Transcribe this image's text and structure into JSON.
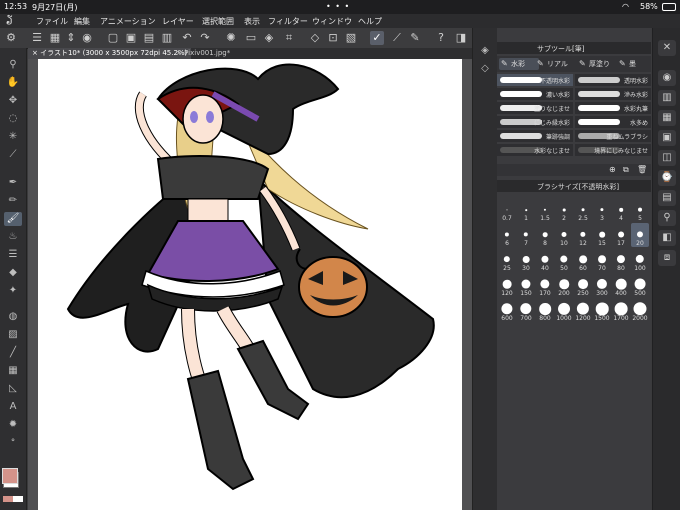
{
  "status": {
    "time": "12:53",
    "date": "9月27日(月)",
    "battery": "58%",
    "dots": "• • •"
  },
  "menu": [
    "ファイル",
    "編集",
    "アニメーション",
    "レイヤー",
    "選択範囲",
    "表示",
    "フィルター",
    "ウィンドウ",
    "ヘルプ"
  ],
  "tabs": [
    {
      "label": "イラスト10* (3000 x 3500px 72dpi 45.2%)"
    },
    {
      "label": "Pixiv001.jpg*"
    }
  ],
  "toolbar": {
    "icons": [
      "zoom-icon",
      "hand-icon",
      "move-icon",
      "lasso-icon",
      "magic-wand-icon",
      "eyedropper-icon",
      "pen-icon",
      "pencil-icon",
      "brush-icon",
      "airbrush-icon",
      "decoration-icon",
      "eraser-icon",
      "blend-icon",
      "fill-icon",
      "gradient-icon",
      "figure-icon",
      "frame-icon",
      "ruler-icon",
      "text-icon",
      "balloon-icon",
      "correction-icon"
    ],
    "main_color": "#d4938a",
    "sub_color": "#ffffff"
  },
  "sub_tool": {
    "title": "サブツール[筆]",
    "tabs": [
      "水彩",
      "リアル",
      "厚塗り",
      "墨"
    ],
    "brushes": [
      {
        "label": "不透明水彩"
      },
      {
        "label": "透明水彩"
      },
      {
        "label": "濃い水彩"
      },
      {
        "label": "滲み水彩"
      },
      {
        "label": "塗りなじませ"
      },
      {
        "label": "水彩丸筆"
      },
      {
        "label": "にじみ縁水彩"
      },
      {
        "label": "水多め"
      },
      {
        "label": "筆跡強調"
      },
      {
        "label": "重ねムラブラシ"
      },
      {
        "label": "水彩なじませ"
      },
      {
        "label": "境界にじみなじませ"
      }
    ]
  },
  "brush_size": {
    "title": "ブラシサイズ[不透明水彩]",
    "sizes": [
      "0.7",
      "1",
      "1.5",
      "2",
      "2.5",
      "3",
      "4",
      "5",
      "6",
      "7",
      "8",
      "10",
      "12",
      "15",
      "17",
      "20",
      "25",
      "30",
      "40",
      "50",
      "60",
      "70",
      "80",
      "100",
      "120",
      "150",
      "170",
      "200",
      "250",
      "300",
      "400",
      "500",
      "600",
      "700",
      "800",
      "1000",
      "1200",
      "1500",
      "1700",
      "2000"
    ],
    "selected": "20"
  }
}
